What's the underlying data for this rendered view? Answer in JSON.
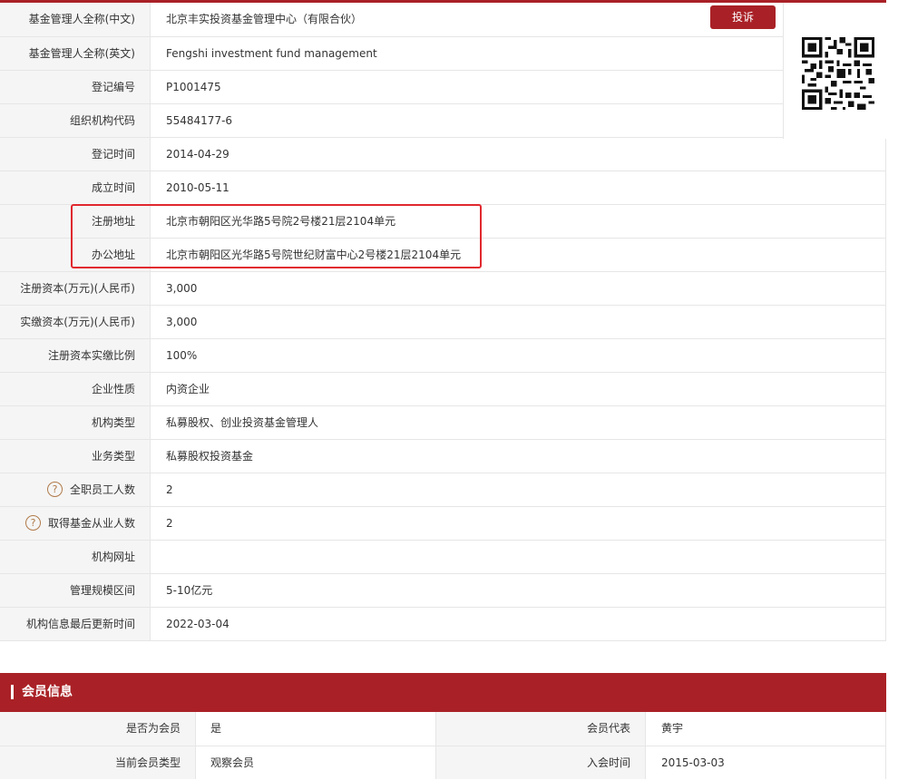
{
  "colors": {
    "accent": "#a92126",
    "highlight": "#e0282e",
    "label_bg": "#f5f5f5"
  },
  "complain_button": "投诉",
  "qr_icon": "qr-code-icon",
  "rows": [
    {
      "label": "基金管理人全称(中文)",
      "value": "北京丰实投资基金管理中心（有限合伙）"
    },
    {
      "label": "基金管理人全称(英文)",
      "value": "Fengshi investment fund management"
    },
    {
      "label": "登记编号",
      "value": "P1001475"
    },
    {
      "label": "组织机构代码",
      "value": "55484177-6"
    },
    {
      "label": "登记时间",
      "value": "2014-04-29"
    },
    {
      "label": "成立时间",
      "value": "2010-05-11"
    },
    {
      "label": "注册地址",
      "value": "北京市朝阳区光华路5号院2号楼21层2104单元"
    },
    {
      "label": "办公地址",
      "value": "北京市朝阳区光华路5号院世纪财富中心2号楼21层2104单元"
    },
    {
      "label": "注册资本(万元)(人民币)",
      "value": "3,000"
    },
    {
      "label": "实缴资本(万元)(人民币)",
      "value": "3,000"
    },
    {
      "label": "注册资本实缴比例",
      "value": "100%"
    },
    {
      "label": "企业性质",
      "value": "内资企业"
    },
    {
      "label": "机构类型",
      "value": "私募股权、创业投资基金管理人"
    },
    {
      "label": "业务类型",
      "value": "私募股权投资基金"
    },
    {
      "label": "全职员工人数",
      "value": "2",
      "help": "?"
    },
    {
      "label": "取得基金从业人数",
      "value": "2",
      "help": "?"
    },
    {
      "label": "机构网址",
      "value": ""
    },
    {
      "label": "管理规模区间",
      "value": "5-10亿元"
    },
    {
      "label": "机构信息最后更新时间",
      "value": "2022-03-04"
    }
  ],
  "member": {
    "title": "会员信息",
    "rows": [
      {
        "label1": "是否为会员",
        "value1": "是",
        "label2": "会员代表",
        "value2": "黄宇"
      },
      {
        "label1": "当前会员类型",
        "value1": "观察会员",
        "label2": "入会时间",
        "value2": "2015-03-03"
      }
    ]
  }
}
